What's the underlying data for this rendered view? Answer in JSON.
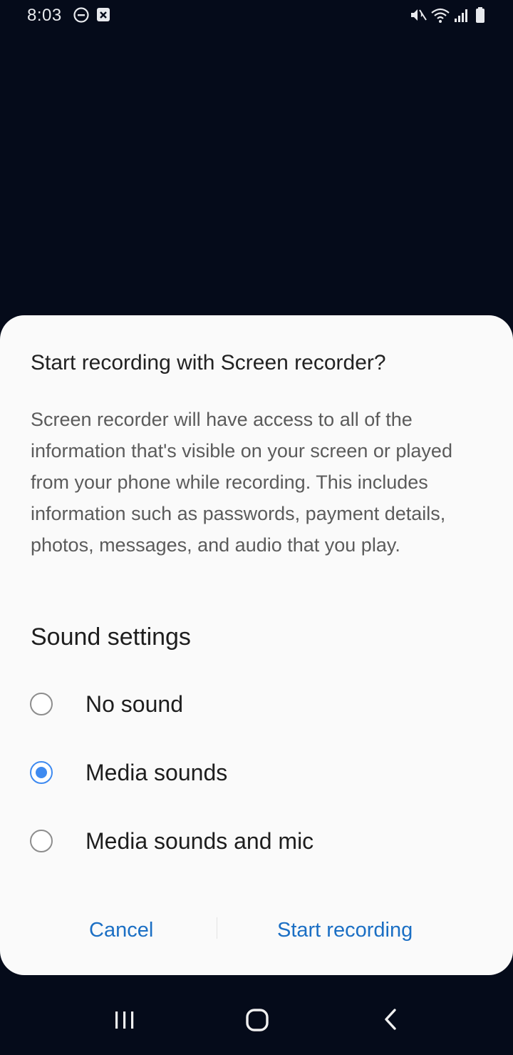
{
  "status_bar": {
    "time": "8:03",
    "left_icons": [
      "do-not-disturb-icon",
      "notification-icon"
    ],
    "right_icons": [
      "mute-icon",
      "wifi-icon",
      "signal-icon",
      "battery-icon"
    ]
  },
  "dialog": {
    "title": "Start recording with Screen recorder?",
    "body": "Screen recorder will have access to all of the information that's visible on your screen or played from your phone while recording. This includes information such as passwords, payment details, photos, messages, and audio that you play.",
    "section_title": "Sound settings",
    "options": [
      {
        "label": "No sound",
        "selected": false
      },
      {
        "label": "Media sounds",
        "selected": true
      },
      {
        "label": "Media sounds and mic",
        "selected": false
      }
    ],
    "cancel_label": "Cancel",
    "confirm_label": "Start recording"
  },
  "nav_bar": {
    "buttons": [
      "recents-icon",
      "home-icon",
      "back-icon"
    ]
  },
  "colors": {
    "accent": "#3e8af0",
    "button_text": "#1b6fc4",
    "background": "#050b1a"
  }
}
